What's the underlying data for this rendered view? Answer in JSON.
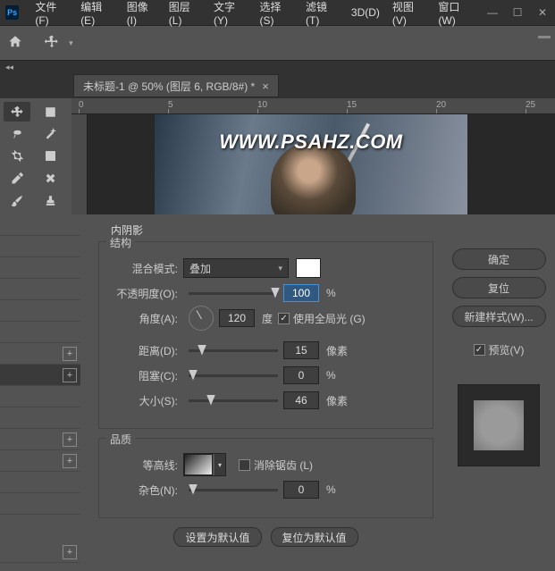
{
  "app": {
    "logo": "Ps"
  },
  "menu": [
    "文件(F)",
    "编辑(E)",
    "图像(I)",
    "图层(L)",
    "文字(Y)",
    "选择(S)",
    "滤镜(T)",
    "3D(D)",
    "视图(V)",
    "窗口(W)"
  ],
  "tab": {
    "title": "未标题-1 @ 50% (图层 6, RGB/8#) *"
  },
  "ruler": {
    "marks": [
      "0",
      "5",
      "10",
      "15",
      "20",
      "25"
    ]
  },
  "canvas": {
    "watermark": "WWW.PSAHZ.COM"
  },
  "dialog": {
    "title": "内阴影",
    "struct_label": "结构",
    "blend_label": "混合模式:",
    "blend_value": "叠加",
    "opacity_label": "不透明度(O):",
    "opacity_value": "100",
    "percent": "%",
    "angle_label": "角度(A):",
    "angle_value": "120",
    "angle_unit": "度",
    "global_light": "使用全局光 (G)",
    "distance_label": "距离(D):",
    "distance_value": "15",
    "px": "像素",
    "choke_label": "阻塞(C):",
    "choke_value": "0",
    "size_label": "大小(S):",
    "size_value": "46",
    "quality_label": "品质",
    "contour_label": "等高线:",
    "antialias": "消除锯齿 (L)",
    "noise_label": "杂色(N):",
    "noise_value": "0",
    "default_btn": "设置为默认值",
    "reset_btn": "复位为默认值"
  },
  "right": {
    "ok": "确定",
    "reset": "复位",
    "newstyle": "新建样式(W)...",
    "preview": "预览(V)"
  }
}
